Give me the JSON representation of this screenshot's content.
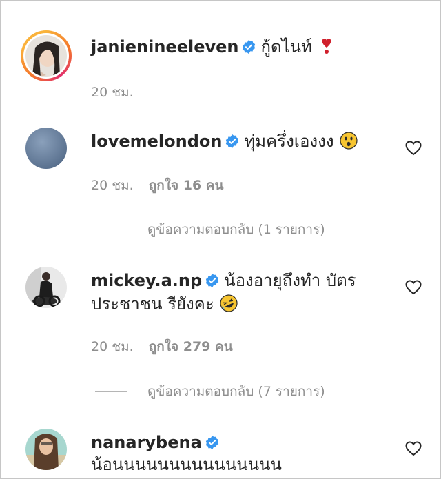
{
  "comments": [
    {
      "username": "janienineeleven",
      "text": "กู้ดไนท์",
      "emoji_icon": "heart-exclamation-icon",
      "time": "20 ชม.",
      "likes": "",
      "replies": ""
    },
    {
      "username": "lovemelondon",
      "text": "ทุ่มครึ่งเองงง",
      "emoji_icon": "surprised-face-icon",
      "time": "20 ชม.",
      "likes": "ถูกใจ 16 คน",
      "replies": "ดูข้อความตอบกลับ (1 รายการ)"
    },
    {
      "username": "mickey.a.np",
      "text": "น้องอายุถึงทำ บัตร",
      "text_line2": "ประชาชน รียังคะ",
      "emoji_icon": "rolling-laughing-face-icon",
      "time": "20 ชม.",
      "likes": "ถูกใจ 279 คน",
      "replies": "ดูข้อความตอบกลับ (7 รายการ)"
    },
    {
      "username": "nanarybena",
      "text": "น้อนนนนนนนนนนนนนนน",
      "time": "",
      "likes": "",
      "replies": ""
    }
  ],
  "colors": {
    "verified": "#3897f0",
    "muted": "#8e8e8e",
    "text": "#262626",
    "emoji_red": "#d0202c",
    "emoji_yellow": "#f7c531"
  }
}
